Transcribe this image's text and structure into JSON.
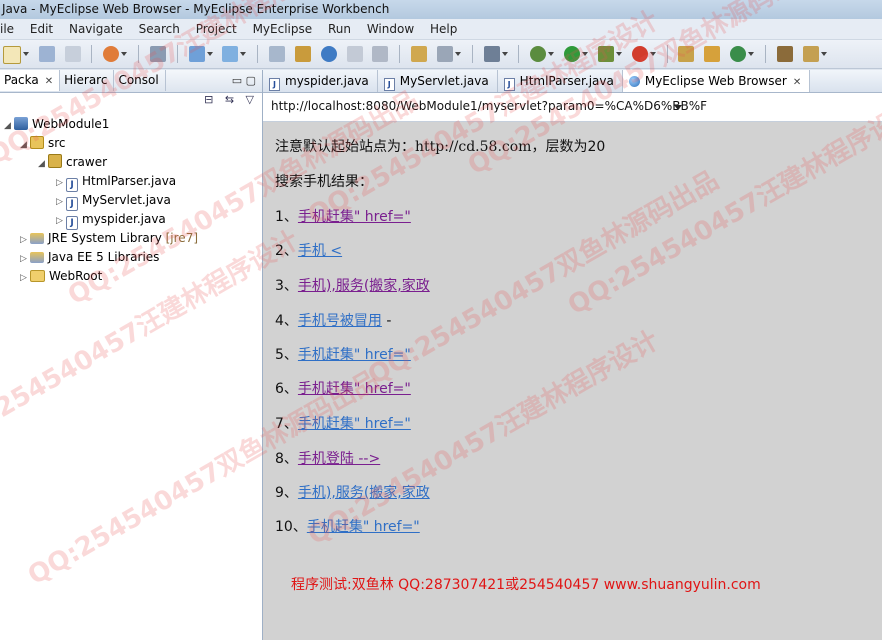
{
  "window": {
    "title": "Java - MyEclipse Web Browser - MyEclipse Enterprise Workbench"
  },
  "menu": [
    "ile",
    "Edit",
    "Navigate",
    "Search",
    "Project",
    "MyEclipse",
    "Run",
    "Window",
    "Help"
  ],
  "left_panel": {
    "tabs": [
      {
        "label": "Packa"
      },
      {
        "label": "Hierarc"
      },
      {
        "label": "Consol"
      }
    ],
    "tree": {
      "project": "WebModule1",
      "src": "src",
      "package": "crawer",
      "files": [
        "HtmlParser.java",
        "MyServlet.java",
        "myspider.java"
      ],
      "jre": "JRE System Library",
      "jre_tag": "[jre7]",
      "javaee": "Java EE 5 Libraries",
      "webroot": "WebRoot"
    }
  },
  "editor_tabs": [
    {
      "label": "myspider.java"
    },
    {
      "label": "MyServlet.java"
    },
    {
      "label": "HtmlParser.java"
    },
    {
      "label": "MyEclipse Web Browser"
    }
  ],
  "browser": {
    "url": "http://localhost:8080/WebModule1/myservlet?param0=%CA%D6%BB%F",
    "notice_prefix": "注意默认起始站点为：",
    "notice_url": "http://cd.58.com",
    "notice_suffix": "，层数为20",
    "results_title": "搜索手机结果：",
    "results": [
      {
        "num": "1、",
        "text": "手机赶集\" href=\"",
        "suffix": ""
      },
      {
        "num": "2、",
        "text": "手机 <",
        "suffix": ""
      },
      {
        "num": "3、",
        "text": "手机),服务(搬家,家政",
        "suffix": ""
      },
      {
        "num": "4、",
        "text": "手机号被冒用",
        "suffix": " -"
      },
      {
        "num": "5、",
        "text": "手机赶集\" href=\"",
        "suffix": ""
      },
      {
        "num": "6、",
        "text": "手机赶集\" href=\"",
        "suffix": ""
      },
      {
        "num": "7、",
        "text": "手机赶集\" href=\"",
        "suffix": ""
      },
      {
        "num": "8、",
        "text": "手机登陆 -->",
        "suffix": ""
      },
      {
        "num": "9、",
        "text": "手机),服务(搬家,家政",
        "suffix": ""
      },
      {
        "num": "10、",
        "text": "手机赶集\" href=\"",
        "suffix": ""
      }
    ],
    "footer": "程序测试:双鱼林 QQ:287307421或254540457 www.shuangyulin.com"
  },
  "watermark": {
    "lines": [
      "QQ:254540457汪建林程序设计",
      "QQ:254540457双鱼林源码出品",
      "QQ:254540457汪建林程序设计",
      "QQ:254540457双鱼林源码出品",
      "QQ:254540457汪建林程序设计",
      "QQ:254540457双鱼林源码出品",
      "QQ:254540457汪建林程序设计",
      "QQ:254540457双鱼林源码出品",
      "QQ:254540457汪建林程序设计"
    ]
  }
}
